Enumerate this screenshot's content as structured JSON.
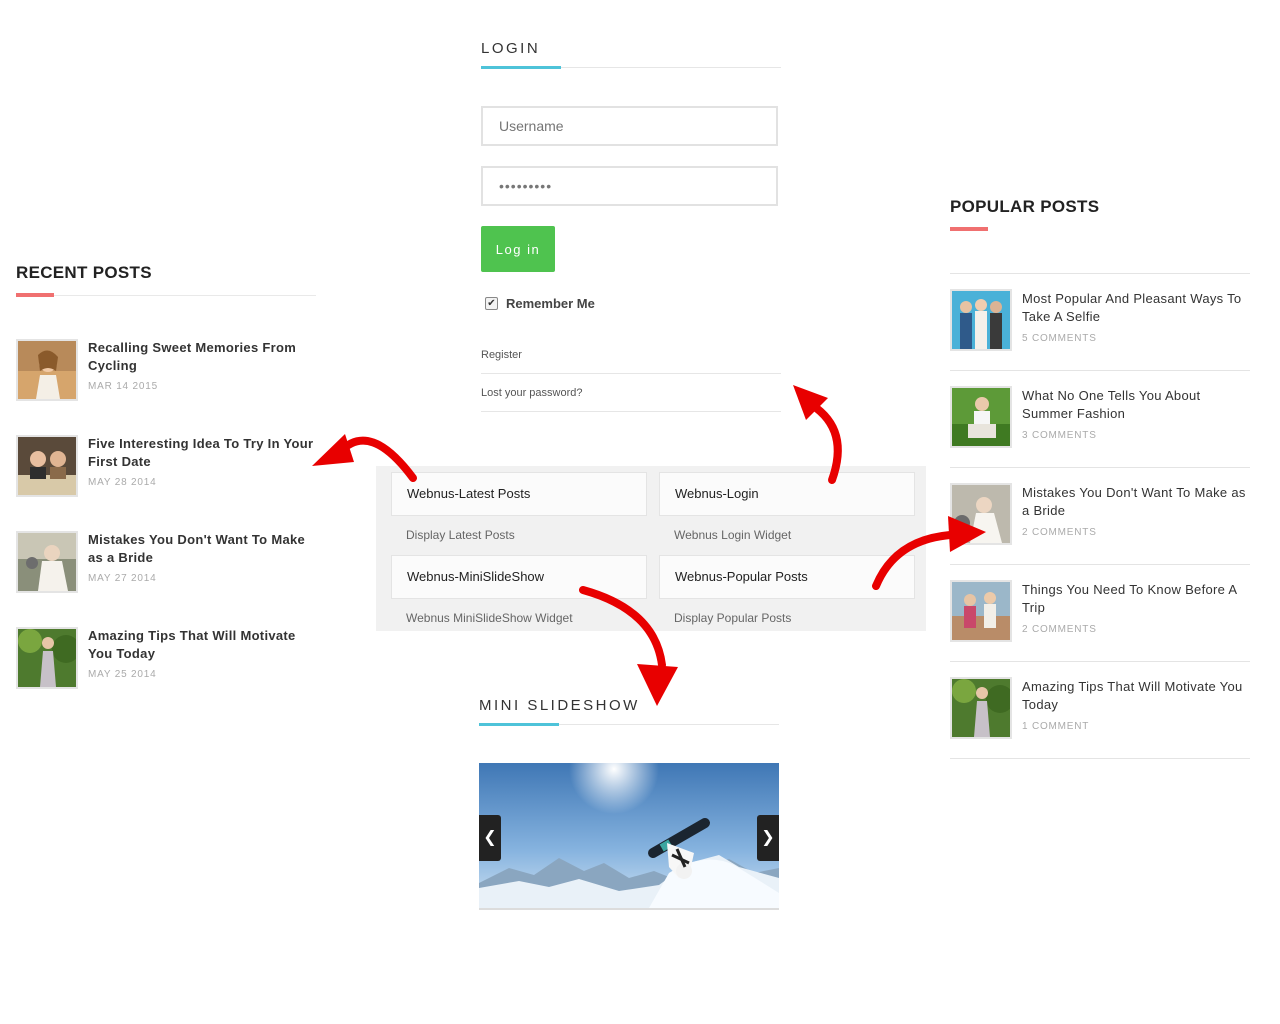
{
  "login": {
    "title": "LOGIN",
    "username_placeholder": "Username",
    "password_value": "•••••••••",
    "button_label": "Log in",
    "remember_label": "Remember Me",
    "register_link": "Register",
    "lost_password_link": "Lost your password?"
  },
  "recent": {
    "title": "RECENT POSTS",
    "items": [
      {
        "title": "Recalling Sweet Memories From Cycling",
        "date": "MAR 14 2015"
      },
      {
        "title": "Five Interesting Idea To Try In Your First Date",
        "date": "MAY 28 2014"
      },
      {
        "title": "Mistakes You Don't Want To Make as a Bride",
        "date": "MAY 27 2014"
      },
      {
        "title": "Amazing Tips That Will Motivate You Today",
        "date": "MAY 25 2014"
      }
    ]
  },
  "popular": {
    "title": "POPULAR POSTS",
    "items": [
      {
        "title": "Most Popular And Pleasant Ways To Take A Selfie",
        "comments": "5 COMMENTS"
      },
      {
        "title": "What No One Tells You About Summer Fashion",
        "comments": "3 COMMENTS"
      },
      {
        "title": "Mistakes You Don't Want To Make as a Bride",
        "comments": "2 COMMENTS"
      },
      {
        "title": "Things You Need To Know Before A Trip",
        "comments": "2 COMMENTS"
      },
      {
        "title": "Amazing Tips That Will Motivate You Today",
        "comments": "1 COMMENT"
      }
    ]
  },
  "widgets": [
    {
      "name": "Webnus-Latest Posts",
      "desc": "Display Latest Posts"
    },
    {
      "name": "Webnus-Login",
      "desc": "Webnus Login Widget"
    },
    {
      "name": "Webnus-MiniSlideShow",
      "desc": "Webnus MiniSlideShow Widget"
    },
    {
      "name": "Webnus-Popular Posts",
      "desc": "Display Popular Posts"
    }
  ],
  "slideshow": {
    "title": "MINI SLIDESHOW",
    "prev_icon": "chevron-left-icon",
    "next_icon": "chevron-right-icon"
  },
  "colors": {
    "accent_blue": "#4ec3d9",
    "accent_red": "#f07070",
    "login_button": "#4fc34f",
    "arrow_red": "#e80000"
  }
}
